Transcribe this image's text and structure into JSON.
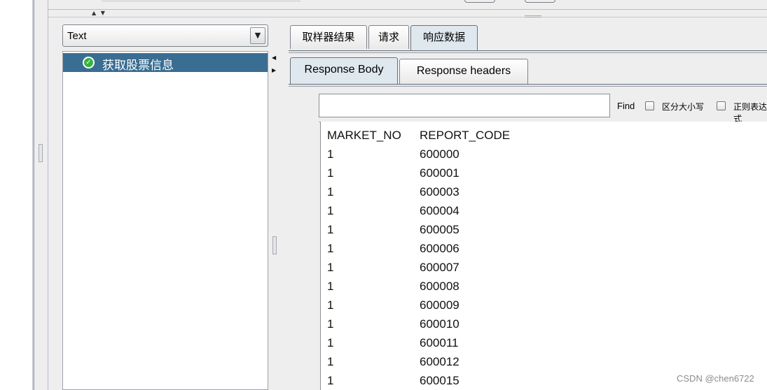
{
  "left_panel": {
    "renderer_combo": {
      "selected": "Text",
      "arrow_icon": "triangle-down"
    },
    "tree": {
      "items": [
        {
          "label": "获取股票信息",
          "status_icon": "success-check",
          "selected": true
        }
      ]
    }
  },
  "right_panel": {
    "result_tabs": [
      {
        "label": "取样器结果",
        "active": false
      },
      {
        "label": "请求",
        "active": false
      },
      {
        "label": "响应数据",
        "active": true
      }
    ],
    "response_tabs": [
      {
        "label": "Response Body",
        "active": true
      },
      {
        "label": "Response headers",
        "active": false
      }
    ],
    "search": {
      "value": "",
      "find_label": "Find",
      "case_sensitive_label": "区分大小写",
      "case_sensitive_checked": false,
      "regex_label": "正则表达式",
      "regex_checked": false
    },
    "response_body": {
      "columns": [
        "MARKET_NO",
        "REPORT_CODE"
      ],
      "rows": [
        [
          "1",
          "600000"
        ],
        [
          "1",
          "600001"
        ],
        [
          "1",
          "600003"
        ],
        [
          "1",
          "600004"
        ],
        [
          "1",
          "600005"
        ],
        [
          "1",
          "600006"
        ],
        [
          "1",
          "600007"
        ],
        [
          "1",
          "600008"
        ],
        [
          "1",
          "600009"
        ],
        [
          "1",
          "600010"
        ],
        [
          "1",
          "600011"
        ],
        [
          "1",
          "600012"
        ],
        [
          "1",
          "600015"
        ]
      ]
    }
  },
  "watermark": "CSDN @chen6722",
  "colors": {
    "selection": "#3a6d92",
    "active_tab": "#dfe7ef",
    "success": "#36b33d",
    "panel_bg": "#eeeeee"
  }
}
